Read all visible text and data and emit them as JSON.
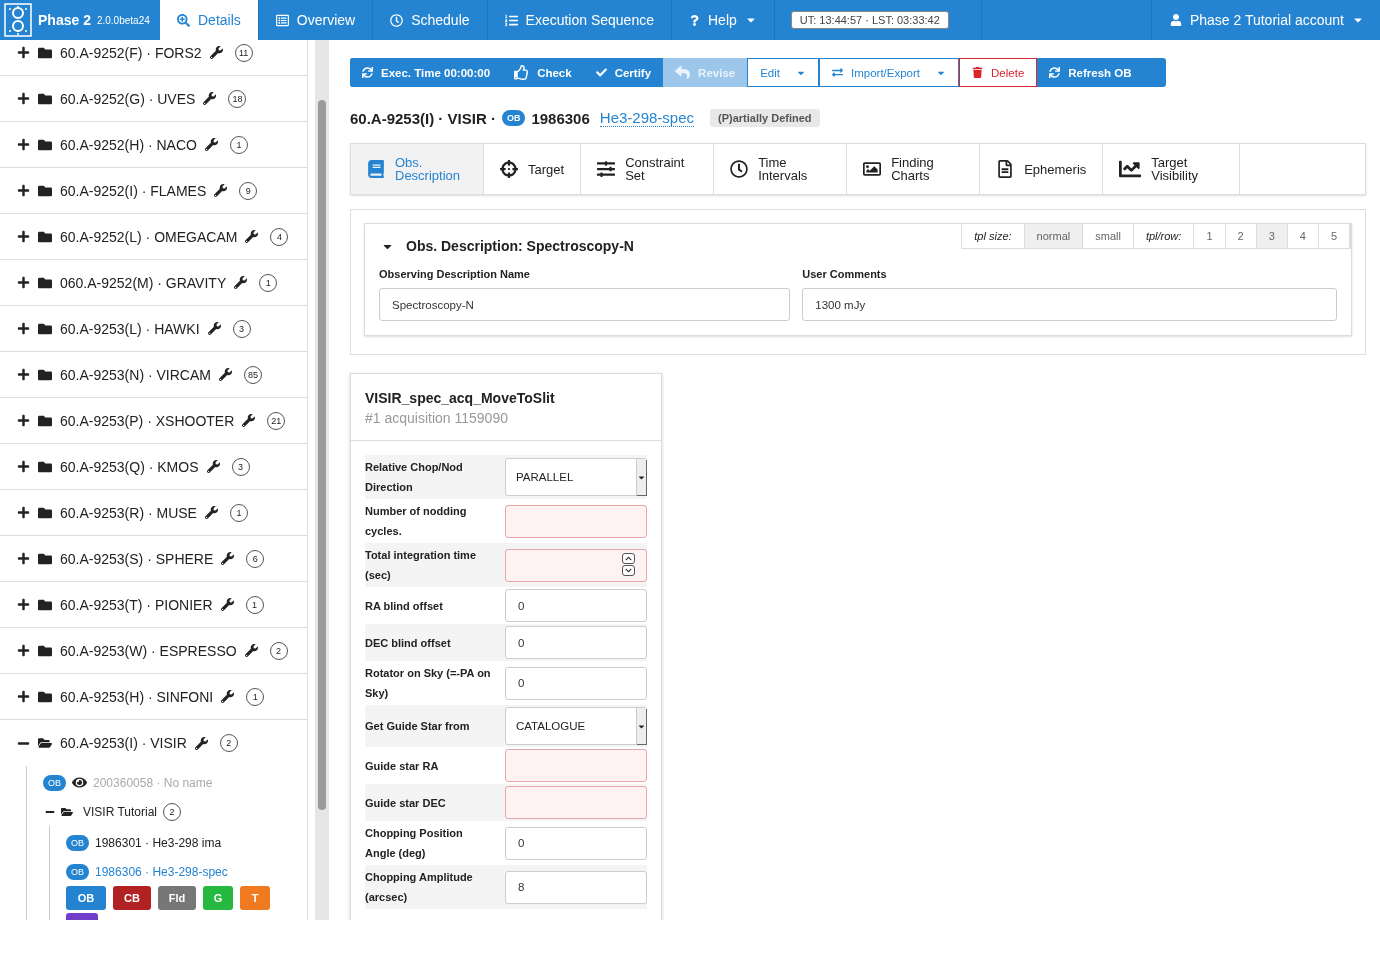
{
  "nav": {
    "app_name": "Phase 2",
    "version": "2.0.0beta24",
    "tabs": [
      {
        "label": "Details",
        "selected": true
      },
      {
        "label": "Overview",
        "selected": false
      },
      {
        "label": "Schedule",
        "selected": false
      },
      {
        "label": "Execution Sequence",
        "selected": false
      }
    ],
    "help": "Help",
    "clock": "UT: 13:44:57 · LST: 03:33:42",
    "account": "Phase 2 Tutorial account"
  },
  "sidebar": {
    "runs": [
      {
        "label": "60.A-9252(F) · FORS2",
        "count": "11",
        "expanded": false
      },
      {
        "label": "60.A-9252(G) · UVES",
        "count": "18",
        "expanded": false
      },
      {
        "label": "60.A-9252(H) · NACO",
        "count": "1",
        "expanded": false
      },
      {
        "label": "60.A-9252(I) · FLAMES",
        "count": "9",
        "expanded": false
      },
      {
        "label": "60.A-9252(L) · OMEGACAM",
        "count": "4",
        "expanded": false
      },
      {
        "label": "060.A-9252(M) · GRAVITY",
        "count": "1",
        "expanded": false
      },
      {
        "label": "60.A-9253(L) · HAWKI",
        "count": "3",
        "expanded": false
      },
      {
        "label": "60.A-9253(N) · VIRCAM",
        "count": "85",
        "expanded": false
      },
      {
        "label": "60.A-9253(P) · XSHOOTER",
        "count": "21",
        "expanded": false
      },
      {
        "label": "60.A-9253(Q) · KMOS",
        "count": "3",
        "expanded": false
      },
      {
        "label": "60.A-9253(R) · MUSE",
        "count": "1",
        "expanded": false
      },
      {
        "label": "60.A-9253(S) · SPHERE",
        "count": "6",
        "expanded": false
      },
      {
        "label": "60.A-9253(T) · PIONIER",
        "count": "1",
        "expanded": false
      },
      {
        "label": "60.A-9253(W) · ESPRESSO",
        "count": "2",
        "expanded": false
      },
      {
        "label": "60.A-9253(H) · SINFONI",
        "count": "1",
        "expanded": false
      },
      {
        "label": "60.A-9253(I) · VISIR",
        "count": "2",
        "expanded": true,
        "children": [
          {
            "kind": "ob",
            "badge": "OB",
            "label": "200360058 · No name",
            "muted": true,
            "selected": false
          },
          {
            "kind": "folder",
            "label": "VISIR Tutorial",
            "count": "2",
            "expanded": true,
            "children": [
              {
                "kind": "ob",
                "badge": "OB",
                "label": "1986301 · He3-298 ima",
                "muted": false,
                "selected": false
              },
              {
                "kind": "ob",
                "badge": "OB",
                "label": "1986306 · He3-298-spec",
                "muted": false,
                "selected": true
              }
            ],
            "actions": [
              {
                "label": "OB",
                "color": "#2584d1"
              },
              {
                "label": "CB",
                "color": "#b22222"
              },
              {
                "label": "Fld",
                "color": "#777777"
              },
              {
                "label": "G",
                "color": "#27b83f"
              },
              {
                "label": "T",
                "color": "#f07a1f"
              },
              {
                "color": "#6f3fc9"
              }
            ]
          }
        ]
      }
    ]
  },
  "toolbar": [
    {
      "kind": "primary",
      "label": "Exec. Time 00:00:00"
    },
    {
      "kind": "primary",
      "label": "Check"
    },
    {
      "kind": "primary",
      "label": "Certify"
    },
    {
      "kind": "disabled",
      "label": "Revise"
    },
    {
      "kind": "outline",
      "label": "Edit",
      "dropdown": true
    },
    {
      "kind": "outline",
      "label": "Import/Export",
      "dropdown": true
    },
    {
      "kind": "danger",
      "label": "Delete"
    },
    {
      "kind": "primary",
      "label": "Refresh OB"
    }
  ],
  "header": {
    "prefix": "60.A-9253(I) · VISIR ·",
    "badge": "OB",
    "id": "1986306",
    "name": "He3-298-spec",
    "status": "(P)artially Defined"
  },
  "ob_tabs": [
    {
      "label": "Obs. Description",
      "selected": true
    },
    {
      "label": "Target",
      "selected": false
    },
    {
      "label": "Constraint Set",
      "selected": false
    },
    {
      "label": "Time Intervals",
      "selected": false
    },
    {
      "label": "Finding Charts",
      "selected": false
    },
    {
      "label": "Ephemeris",
      "selected": false
    },
    {
      "label": "Target Visibility",
      "selected": false
    }
  ],
  "obs_panel": {
    "title": "Obs. Description: Spectroscopy-N",
    "expanded": true,
    "tpl_size": {
      "label": "tpl size:",
      "options": [
        {
          "label": "normal",
          "selected": true
        },
        {
          "label": "small",
          "selected": false
        }
      ]
    },
    "tpl_row": {
      "label": "tpl/row:",
      "options": [
        {
          "label": "1",
          "selected": false
        },
        {
          "label": "2",
          "selected": false
        },
        {
          "label": "3",
          "selected": true
        },
        {
          "label": "4",
          "selected": false
        },
        {
          "label": "5",
          "selected": false
        }
      ]
    },
    "fields": [
      {
        "label": "Observing Description Name",
        "value": "Spectroscopy-N"
      },
      {
        "label": "User Comments",
        "value": "1300 mJy"
      }
    ]
  },
  "template": {
    "title": "VISIR_spec_acq_MoveToSlit",
    "subtitle": "#1 acquisition 1159090",
    "params": [
      {
        "label": "Relative Chop/Nod Direction",
        "kind": "select",
        "value": "PARALLEL"
      },
      {
        "label": "Number of nodding cycles.",
        "kind": "text",
        "invalid": true
      },
      {
        "label": "Total integration time (sec)",
        "kind": "number",
        "invalid": true
      },
      {
        "label": "RA blind offset",
        "kind": "text",
        "value": "0",
        "invalid": false
      },
      {
        "label": "DEC blind offset",
        "kind": "text",
        "value": "0",
        "invalid": false
      },
      {
        "label": "Rotator on Sky (=-PA on Sky)",
        "kind": "text",
        "value": "0",
        "invalid": false
      },
      {
        "label": "Get Guide Star from",
        "kind": "select",
        "value": "CATALOGUE"
      },
      {
        "label": "Guide star RA",
        "kind": "text",
        "invalid": true
      },
      {
        "label": "Guide star DEC",
        "kind": "text",
        "invalid": true
      },
      {
        "label": "Chopping Position Angle (deg)",
        "kind": "text",
        "value": "0",
        "invalid": false
      },
      {
        "label": "Chopping Amplitude (arcsec)",
        "kind": "text",
        "value": "8",
        "invalid": false
      }
    ]
  }
}
